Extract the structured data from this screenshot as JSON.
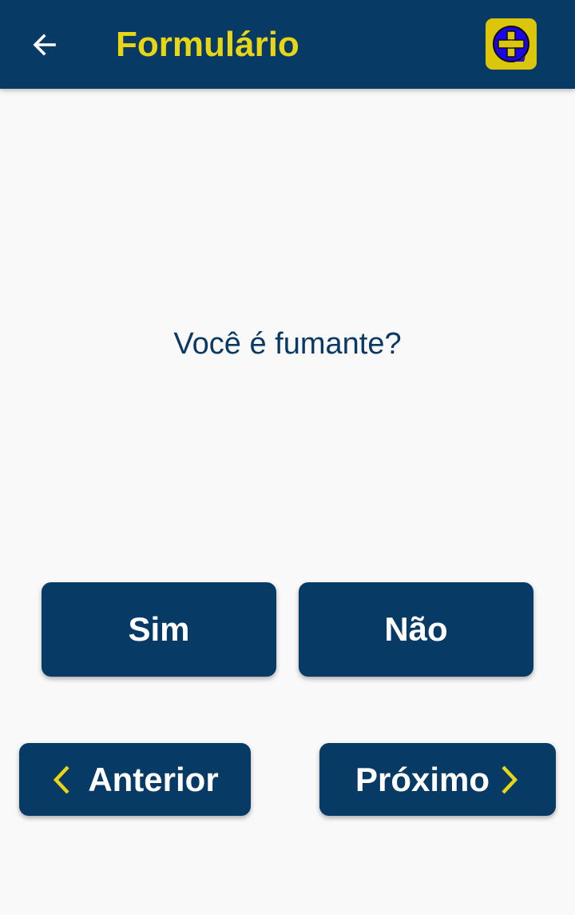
{
  "app_bar": {
    "title": "Formulário",
    "back_icon": "arrow-left-icon",
    "logo_icon": "medical-cross-logo-icon",
    "colors": {
      "background": "#083a66",
      "title": "#e8d514",
      "logo_bg": "#dcc60c",
      "logo_inner": "#1a06e6"
    }
  },
  "question": {
    "text": "Você é fumante?",
    "color": "#0a3a63"
  },
  "answers": {
    "yes_label": "Sim",
    "no_label": "Não"
  },
  "navigation": {
    "prev_label": "Anterior",
    "next_label": "Próximo",
    "prev_icon": "chevron-left-icon",
    "next_icon": "chevron-right-icon",
    "chevron_color": "#e8d514"
  }
}
